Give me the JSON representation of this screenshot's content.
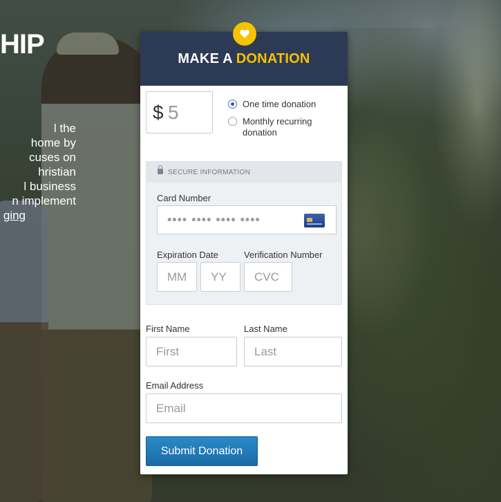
{
  "background": {
    "heading": "HIP",
    "text_lines": [
      "l the",
      "home by",
      "cuses on",
      "hristian",
      "l business",
      "n implement"
    ],
    "link_text": "ging"
  },
  "donation_form": {
    "title_part1": "MAKE A ",
    "title_accent": "DONATION",
    "heart_icon": "heart-icon",
    "amount": {
      "currency": "$",
      "value": "5"
    },
    "frequency_options": [
      {
        "label": "One time donation",
        "checked": true
      },
      {
        "label": "Monthly recurring donation",
        "checked": false
      }
    ],
    "secure": {
      "label": "SECURE INFORMATION",
      "card_number_label": "Card Number",
      "card_number_placeholder": "•••• •••• •••• ••••",
      "expiration_label": "Expiration Date",
      "month_placeholder": "MM",
      "year_placeholder": "YY",
      "verification_label": "Verification Number",
      "cvc_placeholder": "CVC"
    },
    "first_name": {
      "label": "First Name",
      "placeholder": "First"
    },
    "last_name": {
      "label": "Last Name",
      "placeholder": "Last"
    },
    "email": {
      "label": "Email Address",
      "placeholder": "Email"
    },
    "submit_label": "Submit Donation"
  },
  "colors": {
    "header_bg": "#2d3a55",
    "accent": "#f5c300",
    "button": "#1f78b8"
  }
}
